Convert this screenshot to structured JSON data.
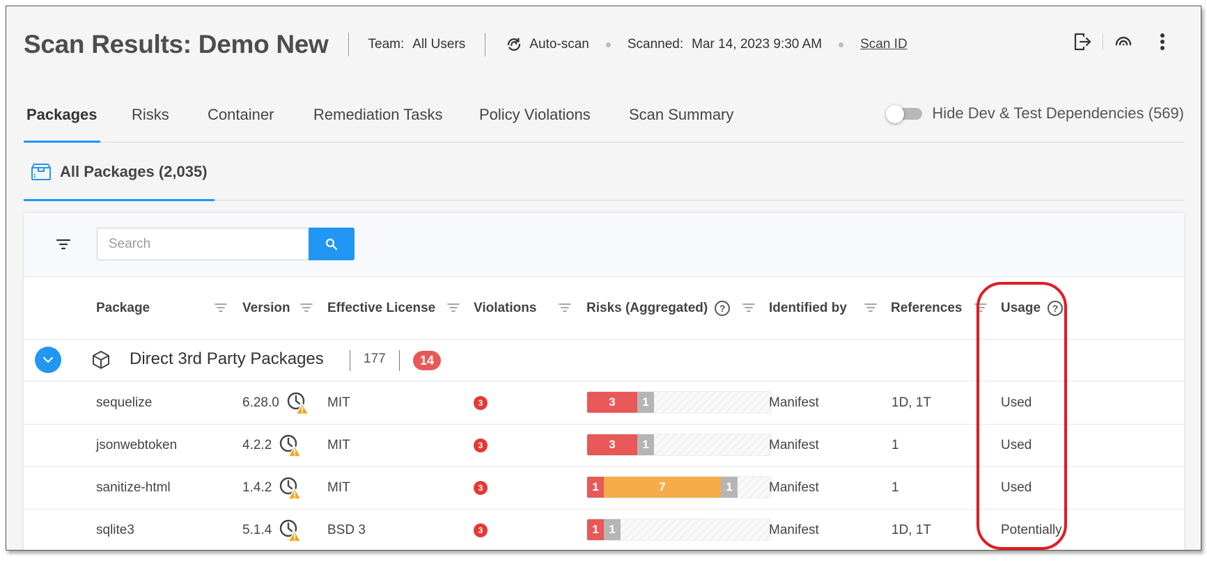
{
  "header": {
    "title": "Scan Results: Demo New",
    "team_label": "Team:",
    "team_value": "All Users",
    "autoscan": "Auto-scan",
    "scanned_label": "Scanned:",
    "scanned_value": "Mar 14, 2023 9:30 AM",
    "scan_id": "Scan ID",
    "actions": [
      "export-icon",
      "rescan-icon",
      "more-vertical-icon"
    ]
  },
  "tabs": [
    {
      "label": "Packages",
      "active": true
    },
    {
      "label": "Risks"
    },
    {
      "label": "Container"
    },
    {
      "label": "Remediation Tasks"
    },
    {
      "label": "Policy Violations"
    },
    {
      "label": "Scan Summary"
    }
  ],
  "toggle": {
    "label": "Hide Dev & Test Dependencies (569)",
    "on": false
  },
  "subtab": {
    "label": "All Packages (2,035)"
  },
  "search": {
    "placeholder": "Search",
    "value": ""
  },
  "columns": [
    "Package",
    "Version",
    "Effective License",
    "Violations",
    "Risks (Aggregated)",
    "Identified by",
    "References",
    "Usage"
  ],
  "group": {
    "label": "Direct 3rd Party Packages",
    "count": "177",
    "badge": "14",
    "expanded": true
  },
  "rows": [
    {
      "package": "sequelize",
      "version": "6.28.0",
      "license": "MIT",
      "violations": "3",
      "risks": [
        {
          "level": "crit",
          "value": "3"
        },
        {
          "level": "low",
          "value": "1"
        }
      ],
      "identified_by": "Manifest",
      "references": "1D, 1T",
      "usage": "Used"
    },
    {
      "package": "jsonwebtoken",
      "version": "4.2.2",
      "license": "MIT",
      "violations": "3",
      "risks": [
        {
          "level": "crit",
          "value": "3"
        },
        {
          "level": "low",
          "value": "1"
        }
      ],
      "identified_by": "Manifest",
      "references": "1",
      "usage": "Used"
    },
    {
      "package": "sanitize-html",
      "version": "1.4.2",
      "license": "MIT",
      "violations": "3",
      "risks": [
        {
          "level": "crit",
          "value": "1"
        },
        {
          "level": "high",
          "value": "7"
        },
        {
          "level": "low",
          "value": "1"
        }
      ],
      "identified_by": "Manifest",
      "references": "1",
      "usage": "Used"
    },
    {
      "package": "sqlite3",
      "version": "5.1.4",
      "license": "BSD 3",
      "violations": "3",
      "risks": [
        {
          "level": "crit",
          "value": "1"
        },
        {
          "level": "low",
          "value": "1"
        }
      ],
      "identified_by": "Manifest",
      "references": "1D, 1T",
      "usage": "Potentially"
    }
  ],
  "colors": {
    "accent": "#2196f3",
    "critical": "#e85858",
    "high": "#f6ac48",
    "low": "#b5b5b5",
    "annotation": "#e01b24"
  }
}
